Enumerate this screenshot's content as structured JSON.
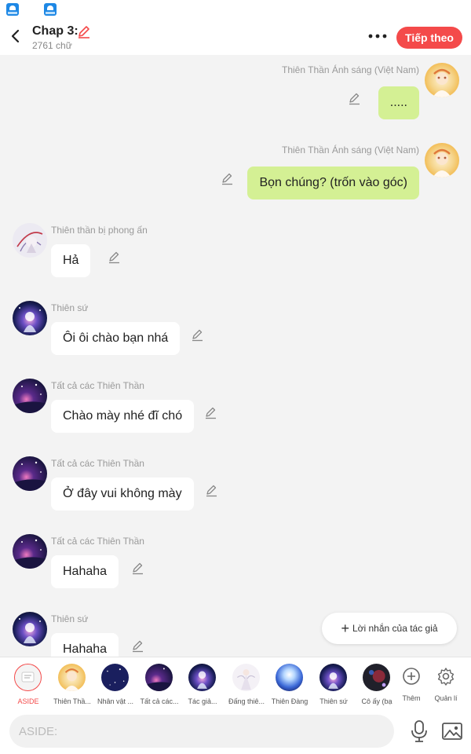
{
  "status_bar": {
    "icons": [
      "app-notification-icon",
      "app-notification-icon"
    ]
  },
  "header": {
    "title": "Chap 3:",
    "subtitle": "2761 chữ",
    "next_label": "Tiếp theo",
    "icons": {
      "back": "back-arrow-icon",
      "edit": "pencil-icon",
      "more": "more-dots-icon"
    }
  },
  "messages": [
    {
      "side": "right",
      "sender": "Thiên Thần Ánh sáng (Việt Nam)",
      "text": "....."
    },
    {
      "side": "right",
      "sender": "Thiên Thần Ánh sáng (Việt Nam)",
      "text": "Bọn chúng? (trốn vào góc)"
    },
    {
      "side": "left",
      "sender": "Thiên thần bị phong ấn",
      "text": "Hả"
    },
    {
      "side": "left",
      "sender": "Thiên sứ",
      "text": "Ôi ôi chào bạn nhá"
    },
    {
      "side": "left",
      "sender": "Tất cả các Thiên Thần",
      "text": "Chào mày nhé đĩ chó"
    },
    {
      "side": "left",
      "sender": "Tất cả các Thiên Thần",
      "text": "Ở đây vui không mày"
    },
    {
      "side": "left",
      "sender": "Tất cả các Thiên Thần",
      "text": "Hahaha"
    },
    {
      "side": "left",
      "sender": "Thiên sứ",
      "text": "Hahaha"
    }
  ],
  "author_note": {
    "label": "Lời nhắn của tác giả",
    "icon": "plus-icon"
  },
  "character_bar": {
    "items": [
      {
        "label": "ASIDE",
        "icon": "aside-icon"
      },
      {
        "label": "Thiên Thầ..."
      },
      {
        "label": "Nhân vật ..."
      },
      {
        "label": "Tất cả các..."
      },
      {
        "label": "Tác giả..."
      },
      {
        "label": "Đấng thiê..."
      },
      {
        "label": "Thiên Đàng"
      },
      {
        "label": "Thiên sứ"
      },
      {
        "label": "Cô ấy (bạ"
      },
      {
        "label": "Thêm",
        "icon": "add-circle-icon"
      },
      {
        "label": "Quản lí",
        "icon": "gear-icon"
      }
    ]
  },
  "input_bar": {
    "placeholder": "ASIDE:",
    "icons": {
      "mic": "microphone-icon",
      "image": "image-icon"
    }
  },
  "colors": {
    "accent": "#f44a4a",
    "right_bubble": "#d4f094",
    "left_bubble": "#ffffff",
    "chat_background": "#f3f3f3"
  }
}
